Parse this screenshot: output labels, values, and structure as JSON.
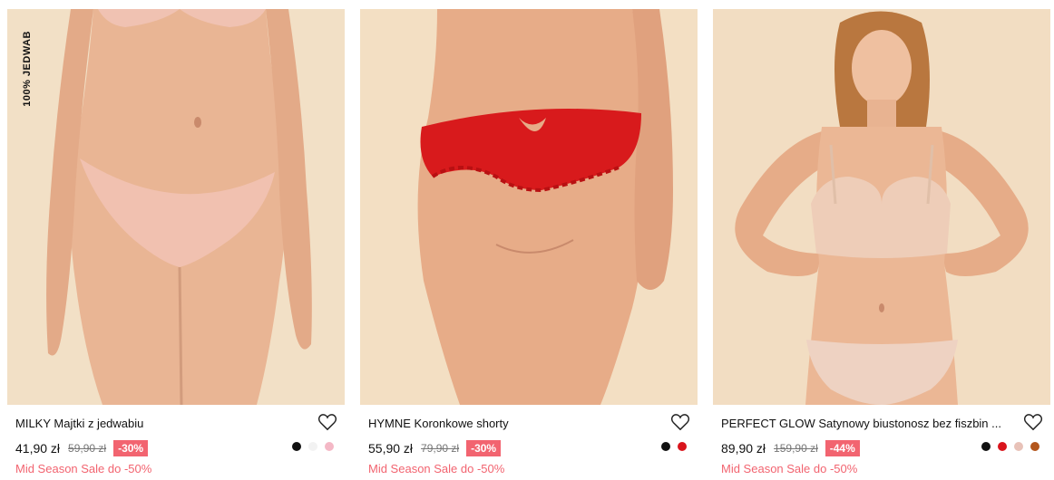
{
  "products": [
    {
      "badge": "100% JEDWAB",
      "name": "MILKY Majtki z jedwabiu",
      "price": "41,90 zł",
      "old_price": "59,90 zł",
      "discount": "-30%",
      "promo": "Mid Season Sale do -50%",
      "swatches": [
        "#111111",
        "#f2f2f2",
        "#f4b8c6"
      ]
    },
    {
      "name": "HYMNE Koronkowe shorty",
      "price": "55,90 zł",
      "old_price": "79,90 zł",
      "discount": "-30%",
      "promo": "Mid Season Sale do -50%",
      "swatches": [
        "#111111",
        "#d9141c"
      ]
    },
    {
      "name": "PERFECT GLOW Satynowy biustonosz bez fiszbin ...",
      "price": "89,90 zł",
      "old_price": "159,90 zł",
      "discount": "-44%",
      "promo": "Mid Season Sale do -50%",
      "swatches": [
        "#111111",
        "#d9141c",
        "#e8c2b8",
        "#b3561c"
      ]
    }
  ],
  "icons": {
    "wishlist": "heart-outline-icon"
  },
  "colors": {
    "accent": "#f26470",
    "background": "#ffffff"
  }
}
